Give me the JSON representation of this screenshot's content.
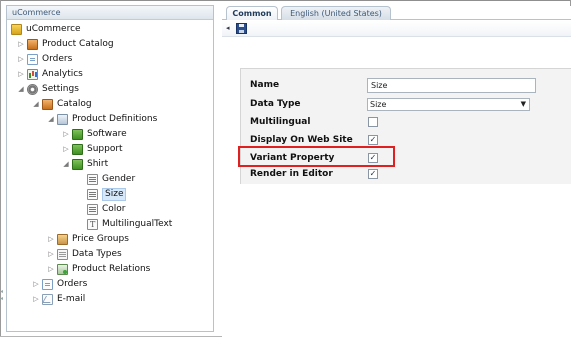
{
  "left_panel": {
    "header_title": "uCommerce",
    "tree": {
      "root": "uCommerce",
      "product_catalog": "Product Catalog",
      "orders": "Orders",
      "analytics": "Analytics",
      "settings": "Settings",
      "catalog": "Catalog",
      "product_definitions": "Product Definitions",
      "software": "Software",
      "support": "Support",
      "shirt": "Shirt",
      "gender": "Gender",
      "size": "Size",
      "color": "Color",
      "multilingual_text": "MultilingualText",
      "price_groups": "Price Groups",
      "data_types": "Data Types",
      "product_relations": "Product Relations",
      "settings_orders": "Orders",
      "email": "E-mail"
    },
    "selected_item": "Size"
  },
  "tabs": {
    "common": "Common",
    "english": "English (United States)"
  },
  "form": {
    "name_label": "Name",
    "name_value": "Size",
    "data_type_label": "Data Type",
    "data_type_value": "Size",
    "multilingual_label": "Multilingual",
    "multilingual_checked": false,
    "display_on_web_site_label": "Display On Web Site",
    "display_on_web_site_checked": true,
    "variant_property_label": "Variant Property",
    "variant_property_checked": true,
    "render_in_editor_label": "Render in Editor",
    "render_in_editor_checked": true
  },
  "icons": {
    "expanded_arrow": "◢",
    "collapsed_arrow": "▷",
    "back": "◂",
    "dropdown": "▼",
    "check": "✓"
  },
  "colors": {
    "highlight_border": "#e02020",
    "selection_bg": "#d7e8fb"
  }
}
